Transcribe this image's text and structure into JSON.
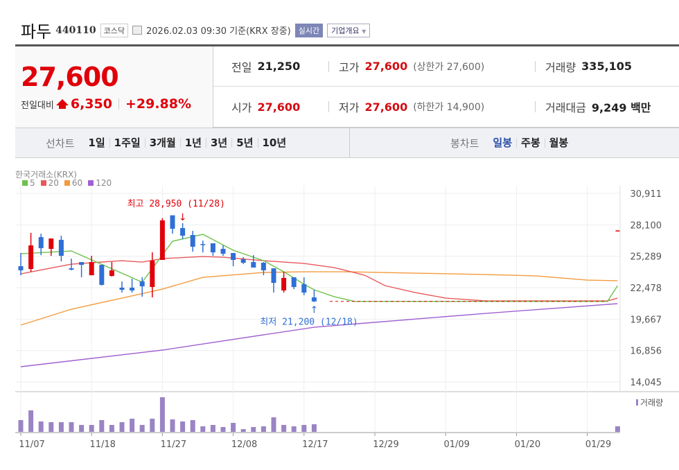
{
  "header": {
    "name": "파두",
    "code": "440110",
    "market": "코스닥",
    "datetime": "2026.02.03 09:30 기준(KRX 장중)",
    "realtime_label": "실시간",
    "company_label": "기업개요"
  },
  "quote": {
    "price": "27,600",
    "change_label": "전일대비",
    "change": "6,350",
    "change_pct": "+29.88%",
    "prev_label": "전일",
    "prev": "21,250",
    "high_label": "고가",
    "high": "27,600",
    "upper_limit": "(상한가 27,600)",
    "volume_label": "거래량",
    "volume": "335,105",
    "open_label": "시가",
    "open": "27,600",
    "low_label": "저가",
    "low": "27,600",
    "lower_limit": "(하한가 14,900)",
    "amount_label": "거래대금",
    "amount": "9,249 백만"
  },
  "tabs": {
    "line_label": "선차트",
    "line": [
      "1일",
      "1주일",
      "3개월",
      "1년",
      "3년",
      "5년",
      "10년"
    ],
    "candle_label": "봉차트",
    "candle": [
      "일봉",
      "주봉",
      "월봉"
    ],
    "candle_selected": 0
  },
  "colors": {
    "up": "#e0000a",
    "down": "#2f6fd6",
    "ma5": "#6cc24a",
    "ma20": "#e8585a",
    "ma60": "#f39a3d",
    "ma120": "#a060d0",
    "volume": "#9a84c4"
  },
  "chart_data": {
    "type": "candlestick",
    "source_label": "한국거래소(KRX)",
    "legend": [
      "5",
      "20",
      "60",
      "120"
    ],
    "yticks": [
      "30,911",
      "28,100",
      "25,289",
      "22,478",
      "19,667",
      "16,856",
      "14,045"
    ],
    "ylim": [
      14045,
      30911
    ],
    "xticks": [
      {
        "i": 0,
        "label": "11/07"
      },
      {
        "i": 7,
        "label": "11/18"
      },
      {
        "i": 14,
        "label": "11/27"
      },
      {
        "i": 21,
        "label": "12/08"
      },
      {
        "i": 28,
        "label": "12/17"
      },
      {
        "i": 35,
        "label": "12/29"
      },
      {
        "i": 42,
        "label": "01/09"
      },
      {
        "i": 49,
        "label": "01/20"
      },
      {
        "i": 56,
        "label": "01/29"
      }
    ],
    "candles_ohlc": [
      [
        24400,
        25580,
        23590,
        24030
      ],
      [
        24150,
        27380,
        23900,
        26260
      ],
      [
        27000,
        27310,
        25390,
        26010
      ],
      [
        25950,
        26880,
        25330,
        26880
      ],
      [
        26760,
        27130,
        24830,
        25330
      ],
      [
        24210,
        25080,
        24030,
        24090
      ],
      [
        24770,
        24770,
        23410,
        24520
      ],
      [
        23590,
        25330,
        23590,
        24770
      ],
      [
        24520,
        24520,
        22670,
        22730
      ],
      [
        23530,
        24770,
        23470,
        24030
      ],
      [
        22480,
        23040,
        22040,
        22290
      ],
      [
        22480,
        23280,
        22040,
        22230
      ],
      [
        23040,
        23410,
        21670,
        22600
      ],
      [
        22540,
        25640,
        21610,
        24900
      ],
      [
        24960,
        28700,
        24960,
        28500
      ],
      [
        28950,
        28950,
        27310,
        27750
      ],
      [
        27810,
        28250,
        26820,
        27130
      ],
      [
        27190,
        27560,
        25700,
        26140
      ],
      [
        26380,
        26690,
        25640,
        26380
      ],
      [
        26450,
        26450,
        25330,
        25640
      ],
      [
        25950,
        26260,
        25330,
        25520
      ],
      [
        25580,
        25580,
        24400,
        24960
      ],
      [
        25020,
        25210,
        24590,
        24710
      ],
      [
        24770,
        25390,
        24280,
        24280
      ],
      [
        24710,
        24770,
        23590,
        24030
      ],
      [
        24210,
        24210,
        22040,
        22910
      ],
      [
        22230,
        23900,
        22040,
        23350
      ],
      [
        23410,
        23410,
        22350,
        22540
      ],
      [
        22790,
        23410,
        21800,
        22040
      ],
      [
        21610,
        22290,
        21200,
        21250
      ]
    ],
    "halt_line": {
      "from": 30,
      "to": 58,
      "price": 21250
    },
    "last_candle": {
      "i": 59,
      "price": 27600
    },
    "ma5": [
      [
        0,
        25515
      ],
      [
        5,
        25763
      ],
      [
        12,
        22973
      ],
      [
        15,
        26631
      ],
      [
        18,
        27251
      ],
      [
        21,
        25825
      ],
      [
        24,
        24895
      ],
      [
        26,
        23903
      ],
      [
        28,
        22787
      ],
      [
        29,
        22291
      ],
      [
        31,
        21671
      ],
      [
        33,
        21250
      ],
      [
        58,
        21250
      ],
      [
        59,
        22663
      ]
    ],
    "ma20": [
      [
        0,
        23717
      ],
      [
        5,
        24585
      ],
      [
        10,
        24895
      ],
      [
        12,
        24771
      ],
      [
        14,
        25081
      ],
      [
        18,
        25267
      ],
      [
        20,
        25205
      ],
      [
        24,
        24895
      ],
      [
        28,
        24647
      ],
      [
        31,
        24275
      ],
      [
        34,
        23593
      ],
      [
        36,
        22663
      ],
      [
        39,
        22043
      ],
      [
        42,
        21547
      ],
      [
        46,
        21299
      ],
      [
        58,
        21299
      ],
      [
        59,
        21547
      ]
    ],
    "ma60": [
      [
        0,
        19129
      ],
      [
        5,
        20555
      ],
      [
        10,
        21547
      ],
      [
        14,
        22353
      ],
      [
        18,
        23407
      ],
      [
        24,
        23841
      ],
      [
        28,
        23903
      ],
      [
        32,
        23903
      ],
      [
        39,
        23779
      ],
      [
        46,
        23655
      ],
      [
        51,
        23531
      ],
      [
        56,
        23159
      ],
      [
        59,
        23097
      ]
    ],
    "ma120": [
      [
        0,
        15409
      ],
      [
        14,
        16897
      ],
      [
        29,
        18943
      ],
      [
        46,
        20183
      ],
      [
        59,
        21051
      ]
    ],
    "volume_relative": [
      17,
      31,
      15,
      14,
      14,
      14,
      10,
      10,
      17,
      10,
      14,
      19,
      10,
      19,
      50,
      18,
      15,
      17,
      8,
      10,
      7,
      13,
      4,
      7,
      8,
      21,
      10,
      8,
      10,
      11
    ],
    "volume_last": {
      "i": 59,
      "value": 8
    },
    "volume_label": "거래량",
    "high_annotation": {
      "i": 15,
      "text": "최고 28,950 (11/28)"
    },
    "low_annotation": {
      "i": 29,
      "text": "최저 21,200 (12/18)"
    }
  }
}
